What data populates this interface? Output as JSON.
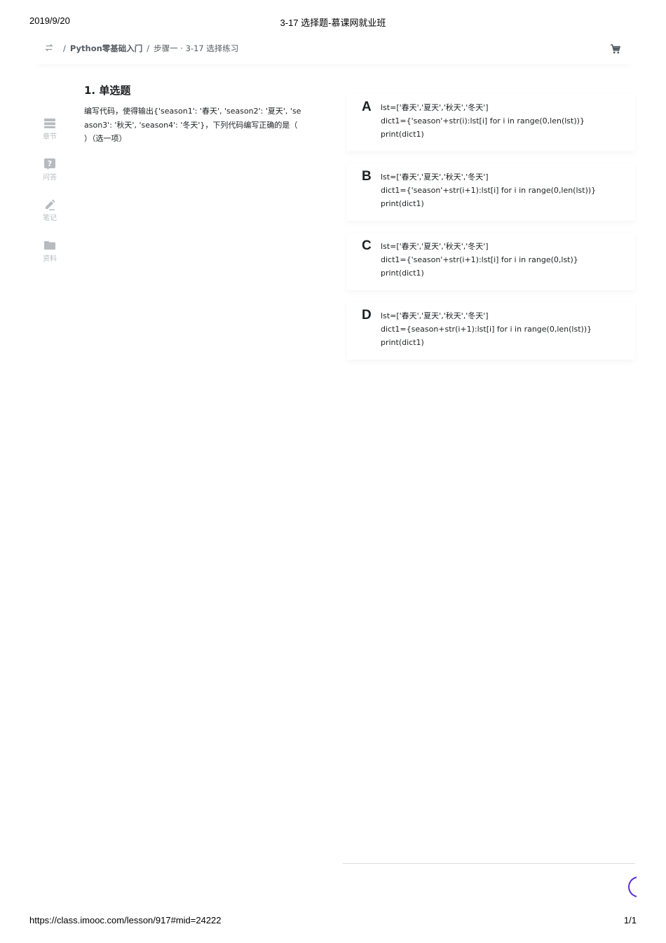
{
  "print_header": {
    "date": "2019/9/20",
    "title": "3-17 选择题-慕课网就业班"
  },
  "breadcrumb": {
    "separator": "/",
    "course": "Python零基础入门",
    "step": "步骤一 · 3-17 选择练习"
  },
  "sidebar": {
    "items": [
      {
        "label": "章节",
        "icon": "chapter-icon"
      },
      {
        "label": "问答",
        "icon": "question-icon"
      },
      {
        "label": "笔记",
        "icon": "note-icon"
      },
      {
        "label": "资料",
        "icon": "folder-icon"
      }
    ]
  },
  "question": {
    "title": "1. 单选题",
    "text": "编写代码，使得输出{'season1': '春天', 'season2': '夏天', 'season3': '秋天', 'season4': '冬天'}，下列代码编写正确的是（   ）（选一项）"
  },
  "options": [
    {
      "letter": "A",
      "lines": [
        "lst=['春天','夏天','秋天','冬天']",
        "dict1={'season'+str(i):lst[i] for i in range(0,len(lst))}",
        "print(dict1)"
      ]
    },
    {
      "letter": "B",
      "lines": [
        "lst=['春天','夏天','秋天','冬天']",
        "dict1={'season'+str(i+1):lst[i] for i in range(0,len(lst))}",
        "print(dict1)"
      ]
    },
    {
      "letter": "C",
      "lines": [
        "lst=['春天','夏天','秋天','冬天']",
        "dict1={'season'+str(i+1):lst[i] for i in range(0,lst)}",
        "print(dict1)"
      ]
    },
    {
      "letter": "D",
      "lines": [
        "lst=['春天','夏天','秋天','冬天']",
        "dict1={season+str(i+1):lst[i] for i in range(0,len(lst))}",
        "print(dict1)"
      ]
    }
  ],
  "print_footer": {
    "url": "https://class.imooc.com/lesson/917#mid=24222",
    "page": "1/1"
  },
  "colors": {
    "text": "#1c1f21",
    "muted": "#b7bbbf",
    "accent": "#5b2ec9"
  }
}
